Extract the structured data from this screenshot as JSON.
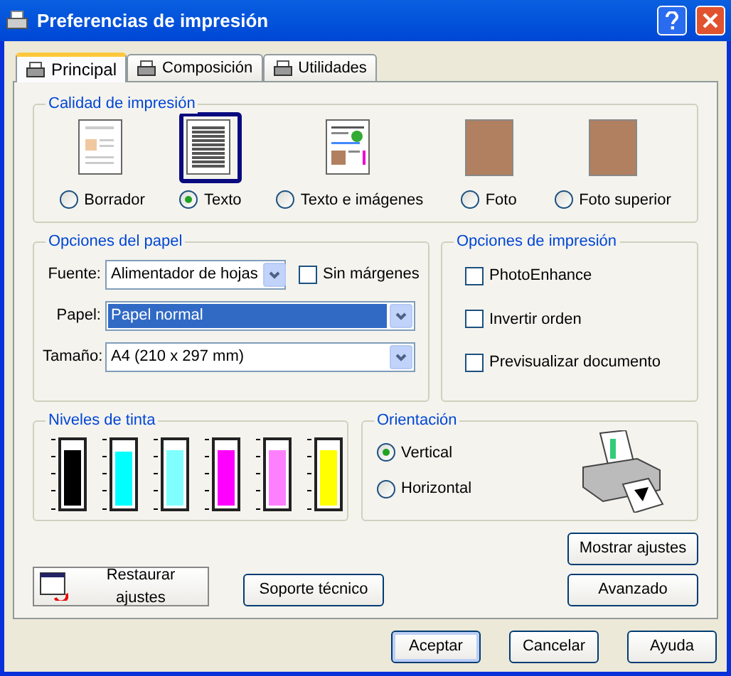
{
  "window": {
    "title": "Preferencias de impresión"
  },
  "tabs": [
    {
      "label": "Principal",
      "selected": true
    },
    {
      "label": "Composición",
      "selected": false
    },
    {
      "label": "Utilidades",
      "selected": false
    }
  ],
  "quality": {
    "title": "Calidad de impresión",
    "options": [
      {
        "label": "Borrador",
        "kind": "draft",
        "selected": false
      },
      {
        "label": "Texto",
        "kind": "text",
        "selected": true
      },
      {
        "label": "Texto e imágenes",
        "kind": "mixed",
        "selected": false
      },
      {
        "label": "Foto",
        "kind": "photo",
        "selected": false
      },
      {
        "label": "Foto superior",
        "kind": "photo",
        "selected": false
      }
    ]
  },
  "paper": {
    "title": "Opciones del papel",
    "source": {
      "label": "Fuente:",
      "value": "Alimentador de hojas"
    },
    "borderless": {
      "label": "Sin márgenes",
      "checked": false
    },
    "type": {
      "label": "Papel:",
      "value": "Papel normal"
    },
    "size": {
      "label": "Tamaño:",
      "value": "A4 (210 x 297 mm)"
    }
  },
  "print_options": {
    "title": "Opciones de impresión",
    "items": [
      {
        "label": "PhotoEnhance",
        "checked": false
      },
      {
        "label": "Invertir orden",
        "checked": false
      },
      {
        "label": "Previsualizar documento",
        "checked": false
      }
    ]
  },
  "ink": {
    "title": "Niveles de tinta",
    "cartridges": [
      {
        "color": "#000000",
        "level": 0.88
      },
      {
        "color": "#00ffff",
        "level": 0.86
      },
      {
        "color": "#80ffff",
        "level": 0.88
      },
      {
        "color": "#ff00ff",
        "level": 0.88
      },
      {
        "color": "#ff80ff",
        "level": 0.88
      },
      {
        "color": "#ffff00",
        "level": 0.88
      }
    ]
  },
  "orientation": {
    "title": "Orientación",
    "options": [
      {
        "label": "Vertical",
        "selected": true
      },
      {
        "label": "Horizontal",
        "selected": false
      }
    ]
  },
  "panel_buttons": {
    "show_settings": "Mostrar ajustes",
    "advanced": "Avanzado",
    "restore": "Restaurar ajustes",
    "support": "Soporte técnico"
  },
  "buttons": [
    "Aceptar",
    "Cancelar",
    "Ayuda"
  ]
}
